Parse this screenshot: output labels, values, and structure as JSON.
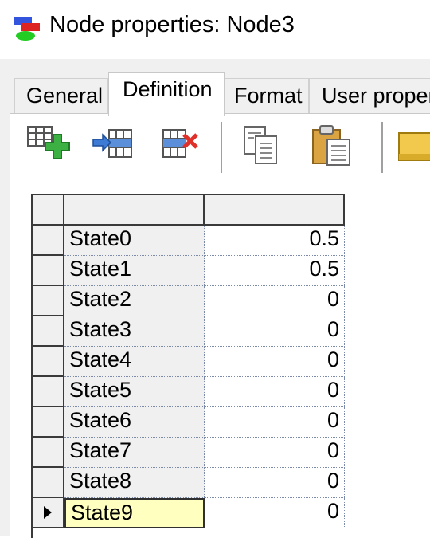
{
  "window": {
    "title": "Node properties: Node3"
  },
  "tabs": [
    {
      "label": "General"
    },
    {
      "label": "Definition"
    },
    {
      "label": "Format"
    },
    {
      "label": "User proper"
    }
  ],
  "active_tab": "Definition",
  "toolbar": {
    "buttons": [
      {
        "name": "add-state-icon"
      },
      {
        "name": "insert-state-icon"
      },
      {
        "name": "delete-state-icon"
      },
      {
        "name": "copy-icon"
      },
      {
        "name": "paste-icon"
      },
      {
        "name": "folder-icon"
      }
    ]
  },
  "table": {
    "header": [
      "",
      ""
    ],
    "rows": [
      {
        "state": "State0",
        "value": "0.5"
      },
      {
        "state": "State1",
        "value": "0.5"
      },
      {
        "state": "State2",
        "value": "0"
      },
      {
        "state": "State3",
        "value": "0"
      },
      {
        "state": "State4",
        "value": "0"
      },
      {
        "state": "State5",
        "value": "0"
      },
      {
        "state": "State6",
        "value": "0"
      },
      {
        "state": "State7",
        "value": "0"
      },
      {
        "state": "State8",
        "value": "0"
      },
      {
        "state": "State9",
        "value": "0"
      }
    ],
    "selected_row": "State9"
  },
  "colors": {
    "selected_cell": "#ffffc0",
    "grid_lines": "#3a3a3a",
    "header_bg": "#f0f0f0"
  }
}
